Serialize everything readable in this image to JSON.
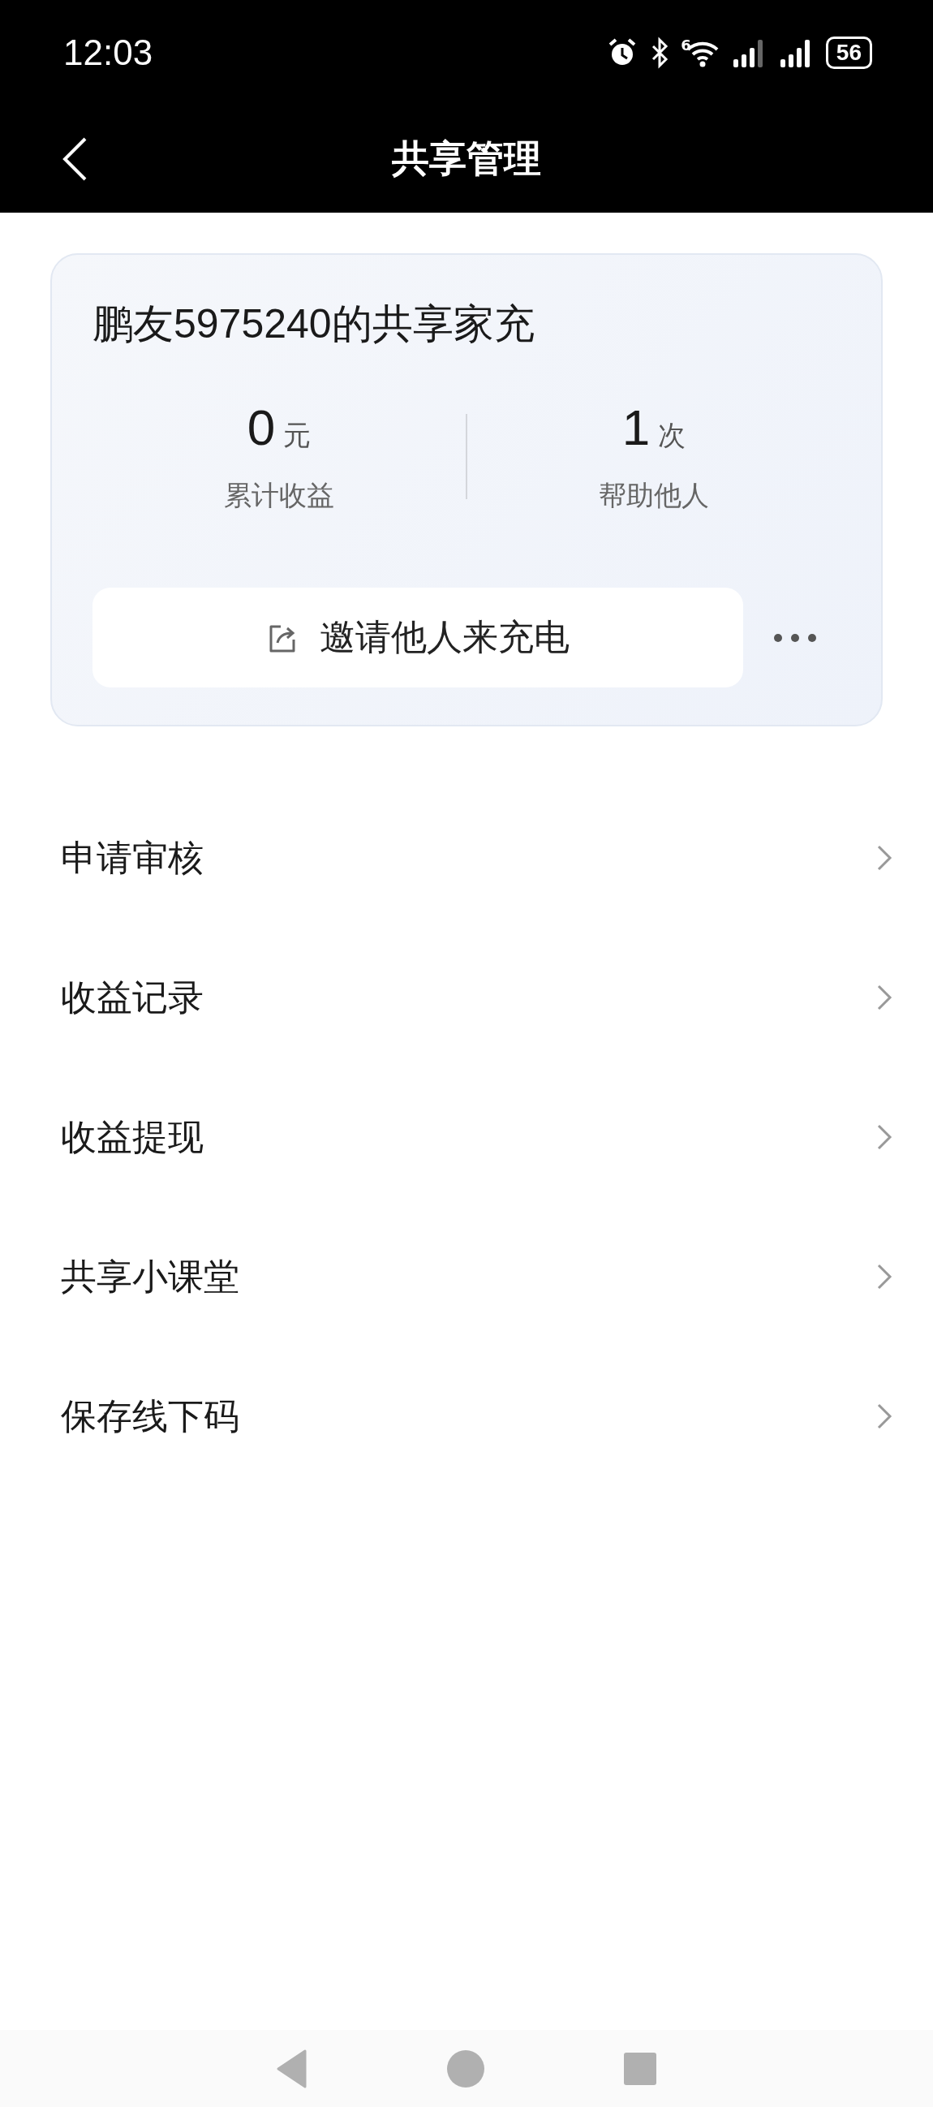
{
  "status_bar": {
    "time": "12:03",
    "network_label": "6",
    "battery": "56"
  },
  "nav": {
    "title": "共享管理"
  },
  "card": {
    "title": "鹏友5975240的共享家充",
    "stats": [
      {
        "value": "0",
        "unit": "元",
        "label": "累计收益"
      },
      {
        "value": "1",
        "unit": "次",
        "label": "帮助他人"
      }
    ],
    "invite_button": "邀请他人来充电"
  },
  "menu": [
    {
      "label": "申请审核"
    },
    {
      "label": "收益记录"
    },
    {
      "label": "收益提现"
    },
    {
      "label": "共享小课堂"
    },
    {
      "label": "保存线下码"
    }
  ]
}
